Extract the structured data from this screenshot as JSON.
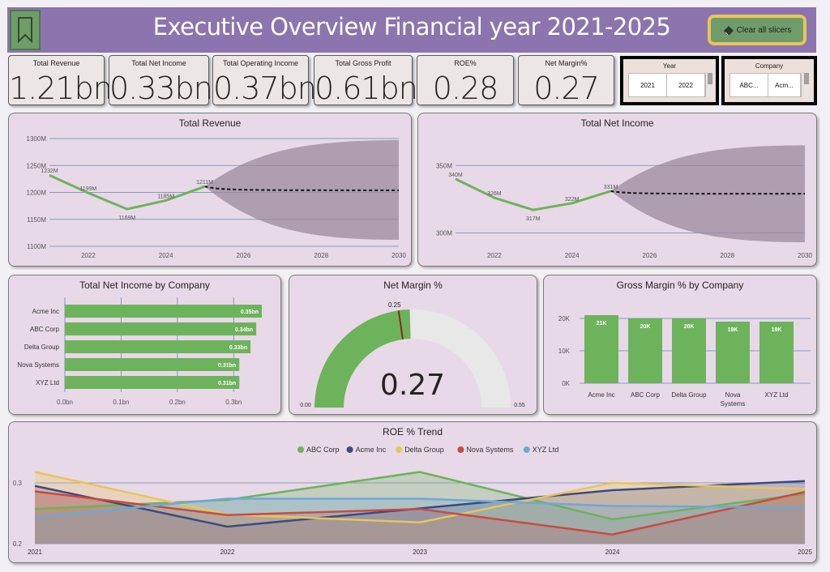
{
  "header": {
    "title": "Executive Overview Financial year 2021-2025",
    "clear_slicers_label": "Clear all slicers",
    "bookmark_icon": "bookmark-icon",
    "eraser_icon": "eraser-icon"
  },
  "kpis": [
    {
      "label": "Total Revenue",
      "value": "1.21bn"
    },
    {
      "label": "Total Net Income",
      "value": "0.33bn"
    },
    {
      "label": "Total Operating Income",
      "value": "0.37bn"
    },
    {
      "label": "Total Gross Profit",
      "value": "0.61bn"
    },
    {
      "label": "ROE%",
      "value": "0.28"
    },
    {
      "label": "Net Margin%",
      "value": "0.27"
    }
  ],
  "slicers": {
    "year": {
      "title": "Year",
      "options": [
        "2021",
        "2022"
      ]
    },
    "company": {
      "title": "Company",
      "options": [
        "ABC...",
        "Acm..."
      ]
    }
  },
  "colors": {
    "green": "#6db35b",
    "header": "#8c74ae",
    "panel": "#e8d9e8",
    "forecast_band": "#9b8a9e"
  },
  "charts": {
    "revenue": {
      "title": "Total Revenue"
    },
    "net_income": {
      "title": "Total Net Income"
    },
    "by_company": {
      "title": "Total Net Income by Company"
    },
    "net_margin": {
      "title": "Net Margin %"
    },
    "gross_margin": {
      "title": "Gross Margin % by Company"
    },
    "roe": {
      "title": "ROE % Trend"
    }
  },
  "chart_data": [
    {
      "type": "line",
      "title": "Total Revenue",
      "x": [
        2021,
        2022,
        2023,
        2024,
        2025
      ],
      "values": [
        1232,
        1199,
        1169,
        1185,
        1211
      ],
      "labels": [
        "1232M",
        "1199M",
        "1169M",
        "1185M",
        "1211M"
      ],
      "forecast": {
        "x": [
          2025,
          2030
        ],
        "value": 1204,
        "upper": [
          1211,
          1297
        ],
        "lower": [
          1211,
          1112
        ]
      },
      "yticks": [
        "1100M",
        "1150M",
        "1200M",
        "1250M",
        "1300M"
      ],
      "ytick_values": [
        1100,
        1150,
        1200,
        1250,
        1300
      ],
      "xticks": [
        "2022",
        "2024",
        "2026",
        "2028",
        "2030"
      ],
      "xtick_values": [
        2022,
        2024,
        2026,
        2028,
        2030
      ],
      "ylim": [
        1100,
        1300
      ],
      "xlim": [
        2021,
        2030
      ]
    },
    {
      "type": "line",
      "title": "Total Net Income",
      "x": [
        2021,
        2022,
        2023,
        2024,
        2025
      ],
      "values": [
        340,
        326,
        317,
        322,
        331
      ],
      "labels": [
        "340M",
        "326M",
        "317M",
        "322M",
        "331M"
      ],
      "forecast": {
        "x": [
          2025,
          2030
        ],
        "value": 329,
        "upper": [
          331,
          365
        ],
        "lower": [
          331,
          293
        ]
      },
      "yticks": [
        "300M",
        "350M"
      ],
      "ytick_values": [
        300,
        350
      ],
      "xticks": [
        "2022",
        "2024",
        "2026",
        "2028",
        "2030"
      ],
      "xtick_values": [
        2022,
        2024,
        2026,
        2028,
        2030
      ],
      "ylim": [
        290,
        370
      ],
      "xlim": [
        2021,
        2030
      ]
    },
    {
      "type": "bar",
      "orientation": "horizontal",
      "title": "Total Net Income by Company",
      "categories": [
        "Acme Inc",
        "ABC Corp",
        "Delta Group",
        "Nova Systems",
        "XYZ Ltd"
      ],
      "values": [
        0.35,
        0.34,
        0.33,
        0.31,
        0.31
      ],
      "labels": [
        "0.35bn",
        "0.34bn",
        "0.33bn",
        "0.31bn",
        "0.31bn"
      ],
      "xticks": [
        "0.0bn",
        "0.1bn",
        "0.2bn",
        "0.3bn"
      ],
      "xtick_values": [
        0,
        0.1,
        0.2,
        0.3
      ],
      "xlim": [
        0,
        0.35
      ]
    },
    {
      "type": "gauge",
      "title": "Net Margin %",
      "value": 0.27,
      "value_label": "0.27",
      "target": 0.25,
      "target_label": "0.25",
      "min": 0,
      "max": 0.55,
      "min_label": "0.00",
      "max_label": "0.55"
    },
    {
      "type": "bar",
      "title": "Gross Margin % by Company",
      "categories": [
        "Acme Inc",
        "ABC Corp",
        "Delta Group",
        "Nova Systems",
        "XYZ Ltd"
      ],
      "category_labels": [
        [
          "Acme Inc"
        ],
        [
          "ABC Corp"
        ],
        [
          "Delta Group"
        ],
        [
          "Nova",
          "Systems"
        ],
        [
          "XYZ Ltd"
        ]
      ],
      "values": [
        21,
        20,
        20,
        19,
        19
      ],
      "labels": [
        "21K",
        "20K",
        "20K",
        "19K",
        "19K"
      ],
      "yticks": [
        "0K",
        "10K",
        "20K"
      ],
      "ytick_values": [
        0,
        10,
        20
      ],
      "ylim": [
        0,
        23
      ]
    },
    {
      "type": "area",
      "title": "ROE % Trend",
      "x": [
        2021,
        2022,
        2023,
        2024,
        2025
      ],
      "xticks": [
        "2021",
        "2022",
        "2023",
        "2024",
        "2025"
      ],
      "yticks": [
        "0.2",
        "0.3"
      ],
      "ytick_values": [
        0.2,
        0.3
      ],
      "ylim": [
        0.2,
        0.32
      ],
      "series": [
        {
          "name": "ABC Corp",
          "color": "#6db35b",
          "values": [
            0.257,
            0.272,
            0.318,
            0.24,
            0.282
          ]
        },
        {
          "name": "Acme Inc",
          "color": "#3f4a7d",
          "values": [
            0.295,
            0.228,
            0.258,
            0.288,
            0.303
          ]
        },
        {
          "name": "Delta Group",
          "color": "#e8c55a",
          "values": [
            0.318,
            0.248,
            0.235,
            0.3,
            0.29
          ]
        },
        {
          "name": "Nova Systems",
          "color": "#c94a43",
          "values": [
            0.286,
            0.247,
            0.257,
            0.215,
            0.285
          ]
        },
        {
          "name": "XYZ Ltd",
          "color": "#6fa7d9",
          "values": [
            0.244,
            0.274,
            0.274,
            0.262,
            0.26
          ]
        }
      ]
    }
  ]
}
